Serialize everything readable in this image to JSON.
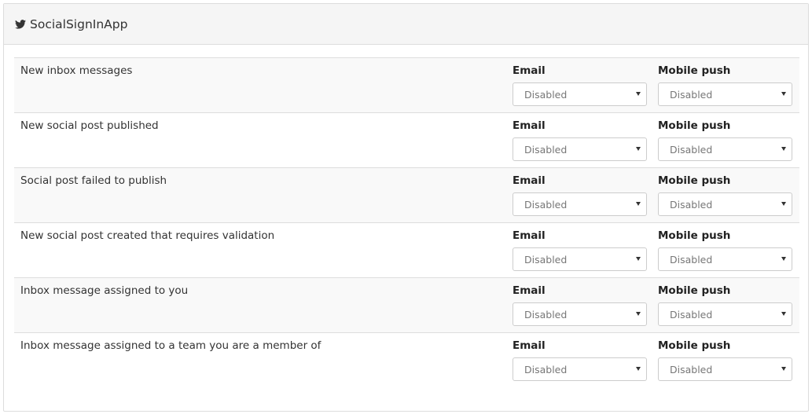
{
  "panel": {
    "title": "SocialSignInApp",
    "icon": "twitter-icon"
  },
  "rows": [
    {
      "label": "New inbox messages",
      "email_title": "Email",
      "push_title": "Mobile push",
      "email_value": "Disabled",
      "push_value": "Disabled"
    },
    {
      "label": "New social post published",
      "email_title": "Email",
      "push_title": "Mobile push",
      "email_value": "Disabled",
      "push_value": "Disabled"
    },
    {
      "label": "Social post failed to publish",
      "email_title": "Email",
      "push_title": "Mobile push",
      "email_value": "Disabled",
      "push_value": "Disabled"
    },
    {
      "label": "New social post created that requires validation",
      "email_title": "Email",
      "push_title": "Mobile push",
      "email_value": "Disabled",
      "push_value": "Disabled"
    },
    {
      "label": "Inbox message assigned to you",
      "email_title": "Email",
      "push_title": "Mobile push",
      "email_value": "Disabled",
      "push_value": "Disabled"
    },
    {
      "label": "Inbox message assigned to a team you are a member of",
      "email_title": "Email",
      "push_title": "Mobile push",
      "email_value": "Disabled",
      "push_value": "Disabled"
    }
  ],
  "colors": {
    "heading_bg": "#f5f5f5",
    "striped_row_bg": "#f9f9f9",
    "border": "#dddddd"
  }
}
